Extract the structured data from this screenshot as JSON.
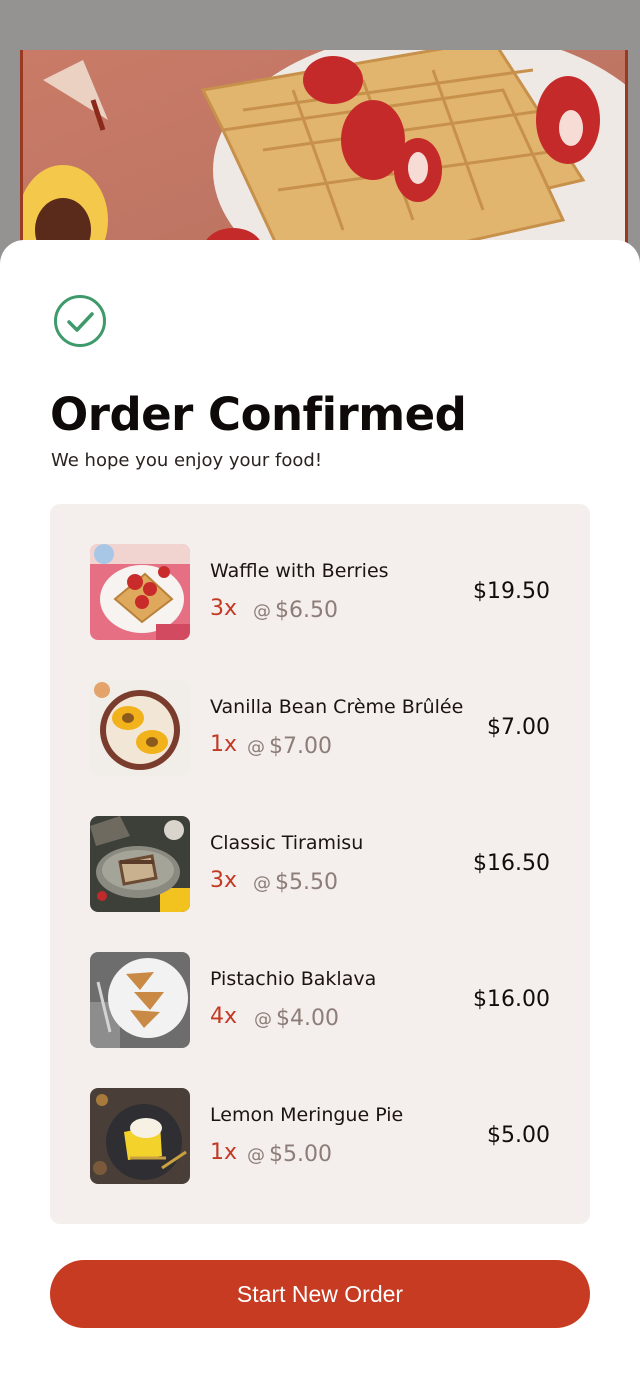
{
  "order": {
    "title": "Order Confirmed",
    "subtitle": "We hope you enjoy your food!",
    "items": [
      {
        "name": "Waffle with Berries",
        "qty": "3x",
        "unit_price": "$6.50",
        "total": "$19.50"
      },
      {
        "name": "Vanilla Bean Crème Brûlée",
        "qty": "1x",
        "unit_price": "$7.00",
        "total": "$7.00"
      },
      {
        "name": "Classic Tiramisu",
        "qty": "3x",
        "unit_price": "$5.50",
        "total": "$16.50"
      },
      {
        "name": "Pistachio Baklava",
        "qty": "4x",
        "unit_price": "$4.00",
        "total": "$16.00"
      },
      {
        "name": "Lemon Meringue Pie",
        "qty": "1x",
        "unit_price": "$5.00",
        "total": "$5.00"
      }
    ],
    "unit_prefix": "@"
  },
  "actions": {
    "new_order_label": "Start New Order"
  },
  "icons": {
    "status": "check-circle-icon"
  },
  "colors": {
    "accent": "#c63b22",
    "success": "#3f9a6b",
    "panel": "#f4eeec",
    "muted": "#8d7d78"
  }
}
